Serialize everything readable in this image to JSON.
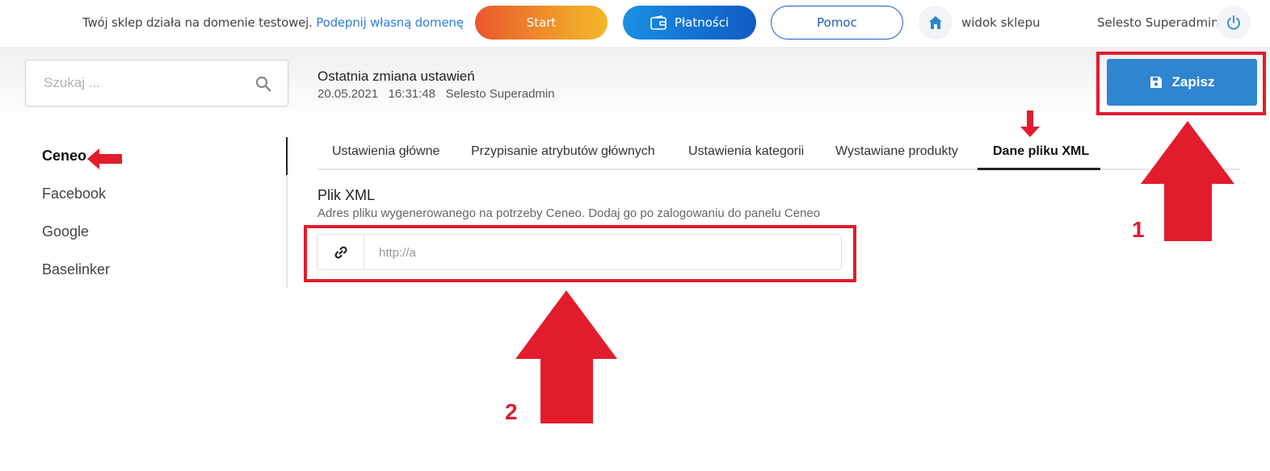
{
  "topbar": {
    "domain_text": "Twój sklep działa na domenie testowej.",
    "domain_link": "Podepnij własną domenę",
    "start_label": "Start",
    "payments_label": "Płatności",
    "help_label": "Pomoc",
    "shop_view_label": "widok sklepu",
    "user_name": "Selesto Superadmin"
  },
  "header": {
    "search_placeholder": "Szukaj ...",
    "last_change_title": "Ostatnia zmiana ustawień",
    "last_change_date": "20.05.2021",
    "last_change_time": "16:31:48",
    "last_change_user": "Selesto Superadmin",
    "save_label": "Zapisz"
  },
  "sidebar": {
    "items": [
      {
        "label": "Ceneo",
        "active": true
      },
      {
        "label": "Facebook",
        "active": false
      },
      {
        "label": "Google",
        "active": false
      },
      {
        "label": "Baselinker",
        "active": false
      }
    ]
  },
  "tabs": [
    {
      "label": "Ustawienia główne",
      "active": false
    },
    {
      "label": "Przypisanie atrybutów głównych",
      "active": false
    },
    {
      "label": "Ustawienia kategorii",
      "active": false
    },
    {
      "label": "Wystawiane produkty",
      "active": false
    },
    {
      "label": "Dane pliku XML",
      "active": true
    }
  ],
  "xml": {
    "title": "Plik XML",
    "description": "Adres pliku wygenerowanego na potrzeby Ceneo. Dodaj go po zalogowaniu do panelu Ceneo",
    "url_value": "http://a"
  },
  "annotations": {
    "label_1": "1",
    "label_2": "2",
    "color": "#e21c2c"
  },
  "colors": {
    "primary": "#2f85d0",
    "link": "#2f7fd8",
    "start_gradient": [
      "#e9572c",
      "#f2b628"
    ],
    "payments_gradient": [
      "#1a8fe3",
      "#0f5bc4"
    ]
  }
}
